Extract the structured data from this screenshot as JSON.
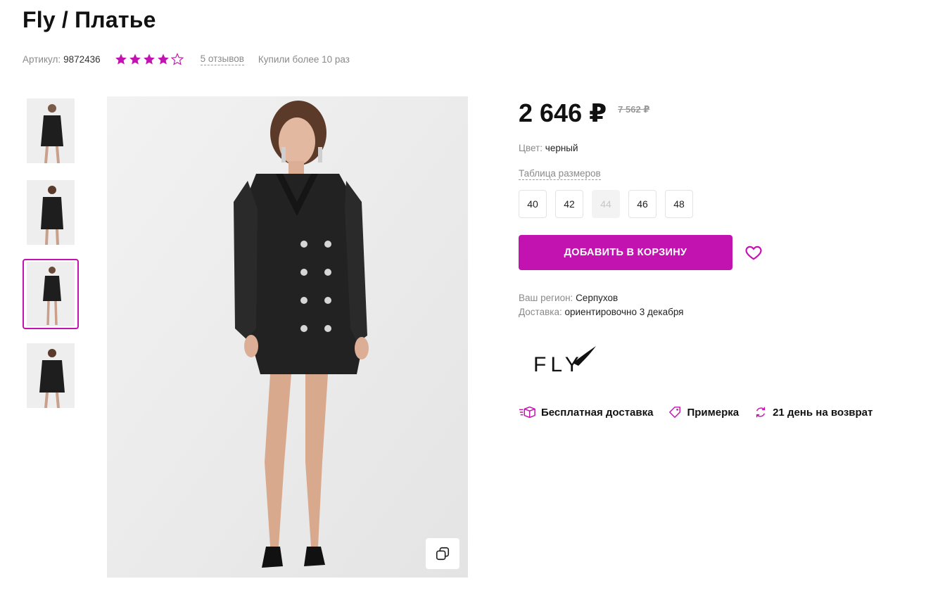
{
  "product": {
    "title": "Fly / Платье",
    "article_label": "Артикул:",
    "article_value": "9872436",
    "rating": 4,
    "rating_max": 5,
    "reviews_label": "5 отзывов",
    "bought_label": "Купили более 10 раз"
  },
  "gallery": {
    "thumbnails": [
      "thumb-1",
      "thumb-2",
      "thumb-3",
      "thumb-4"
    ],
    "active_index": 2
  },
  "pricing": {
    "price": "2 646 ₽",
    "old_price": "7 562 ₽"
  },
  "color": {
    "label": "Цвет:",
    "value": "черный"
  },
  "size_table_label": "Таблица размеров",
  "sizes": [
    {
      "label": "40",
      "available": true
    },
    {
      "label": "42",
      "available": true
    },
    {
      "label": "44",
      "available": false
    },
    {
      "label": "46",
      "available": true
    },
    {
      "label": "48",
      "available": true
    }
  ],
  "cart_button_label": "ДОБАВИТЬ В КОРЗИНУ",
  "delivery": {
    "region_label": "Ваш регион:",
    "region_value": "Серпухов",
    "delivery_label": "Доставка:",
    "delivery_value": "ориентировочно 3 декабря"
  },
  "brand": {
    "logo_text": "FLY"
  },
  "features": [
    {
      "icon": "delivery-box-icon",
      "label": "Бесплатная доставка"
    },
    {
      "icon": "tag-icon",
      "label": "Примерка"
    },
    {
      "icon": "return-arrows-icon",
      "label": "21 день на возврат"
    }
  ],
  "colors": {
    "accent": "#c213b0",
    "text": "#111111",
    "muted": "#8a8a8a"
  }
}
